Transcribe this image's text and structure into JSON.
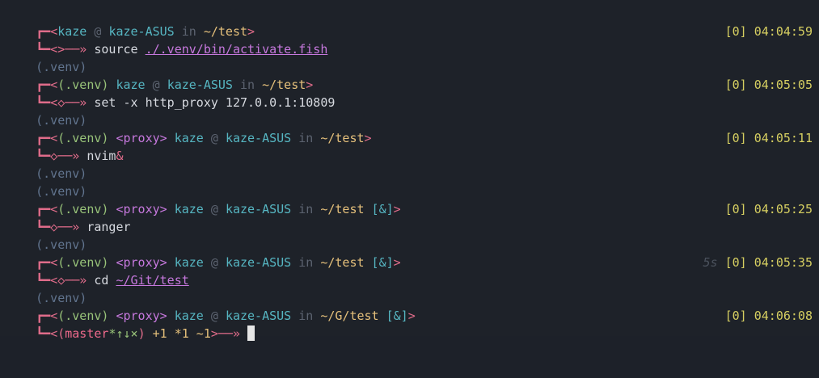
{
  "terminal": {
    "blocks": [
      {
        "prompt_line": {
          "corner": "┏━",
          "open": "<",
          "venv": "",
          "proxy": "",
          "user": "kaze",
          "at": " @ ",
          "host": "kaze-ASUS",
          "in": " in ",
          "path": "~/test",
          "jobs": "",
          "close": ">"
        },
        "cmd_line": {
          "corner": "┗━",
          "arrow": "<>──»",
          "command": "source",
          "arg": "./.venv/bin/activate.fish",
          "duration": "",
          "status": "[0]",
          "time": "04:04:59"
        }
      },
      {
        "venv_after": "(.venv)",
        "prompt_line": {
          "corner": "┏━",
          "open": "<",
          "venv": "(.venv) ",
          "proxy": "",
          "user": "kaze",
          "at": " @ ",
          "host": "kaze-ASUS",
          "in": " in ",
          "path": "~/test",
          "jobs": "",
          "close": ">"
        },
        "cmd_line": {
          "corner": "┗━",
          "arrow": "<◇──»",
          "command": "set",
          "arg": "-x http_proxy 127.0.0.1:10809",
          "duration": "",
          "status": "[0]",
          "time": "04:05:05"
        }
      },
      {
        "venv_after": "(.venv)",
        "prompt_line": {
          "corner": "┏━",
          "open": "<",
          "venv": "(.venv) ",
          "proxy": "<proxy> ",
          "user": "kaze",
          "at": " @ ",
          "host": "kaze-ASUS",
          "in": " in ",
          "path": "~/test",
          "jobs": "",
          "close": ">"
        },
        "cmd_line": {
          "corner": "┗━",
          "arrow": "◇──»",
          "command": "nvim",
          "arg": "&",
          "duration": "",
          "status": "[0]",
          "time": "04:05:11"
        }
      },
      {
        "venv_after": "(.venv)",
        "venv_after2": "(.venv)",
        "prompt_line": {
          "corner": "┏━",
          "open": "<",
          "venv": "(.venv) ",
          "proxy": "<proxy> ",
          "user": "kaze",
          "at": " @ ",
          "host": "kaze-ASUS",
          "in": " in ",
          "path": "~/test",
          "jobs": " [&]",
          "close": ">"
        },
        "cmd_line": {
          "corner": "┗━",
          "arrow": "◇──»",
          "command": "ranger",
          "arg": "",
          "duration": "",
          "status": "[0]",
          "time": "04:05:25"
        }
      },
      {
        "venv_after": "(.venv)",
        "prompt_line": {
          "corner": "┏━",
          "open": "<",
          "venv": "(.venv) ",
          "proxy": "<proxy> ",
          "user": "kaze",
          "at": " @ ",
          "host": "kaze-ASUS",
          "in": " in ",
          "path": "~/test",
          "jobs": " [&]",
          "close": ">"
        },
        "cmd_line": {
          "corner": "┗━",
          "arrow": "<◇──»",
          "command": "cd",
          "arg": "~/Git/test",
          "duration": "5s",
          "status": "[0]",
          "time": "04:05:35"
        }
      },
      {
        "venv_after": "(.venv)",
        "prompt_line": {
          "corner": "┏━",
          "open": "<",
          "venv": "(.venv) ",
          "proxy": "<proxy> ",
          "user": "kaze",
          "at": " @ ",
          "host": "kaze-ASUS",
          "in": " in ",
          "path": "~/G/test",
          "jobs": " [&]",
          "close": ">"
        },
        "cmd_line": {
          "corner": "┗━",
          "git_open": "<(",
          "git_branch": "master",
          "git_flags": "*↑↓×",
          "git_close": ")",
          "git_stats": " +1 *1 ~1",
          "git_end": ">──»",
          "status": "[0]",
          "time": "04:06:08"
        }
      }
    ]
  }
}
